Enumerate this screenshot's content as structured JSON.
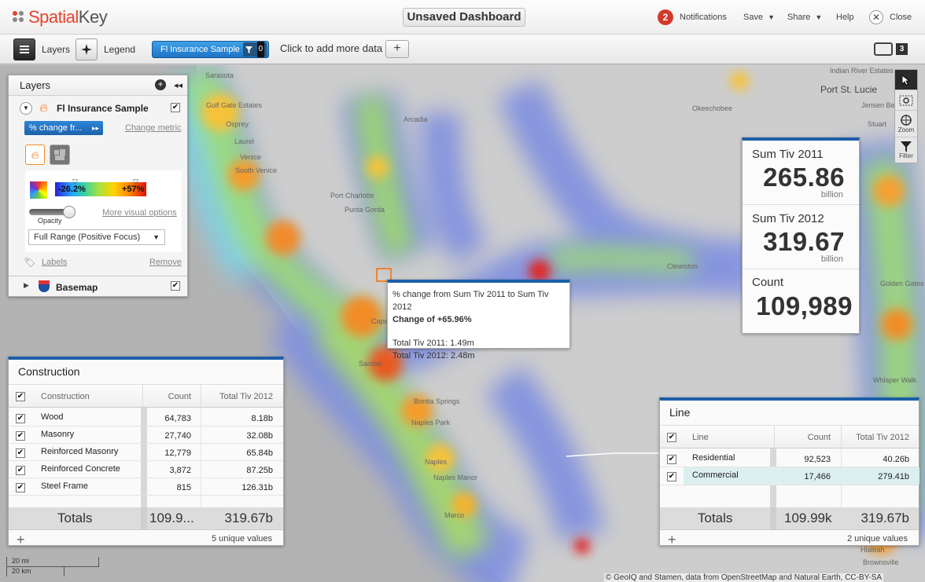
{
  "app": {
    "logo": "SpatialKey",
    "dashboard_title": "Unsaved Dashboard"
  },
  "topmenu": {
    "notif_count": "2",
    "notifications": "Notifications",
    "save": "Save",
    "share": "Share",
    "help": "Help",
    "close": "Close"
  },
  "toolbar": {
    "layers": "Layers",
    "legend": "Legend",
    "dataset": "Fl Insurance Sample",
    "dataset_filter_count": "0",
    "add_data_text": "Click to add more data",
    "add_data_symbol": "+",
    "screen_count": "3"
  },
  "layers_panel": {
    "title": "Layers",
    "layer_name": "Fl Insurance Sample",
    "metric": "% change fr...",
    "change_metric": "Change metric",
    "range_min": "-26.2%",
    "range_max": "+57%",
    "opacity_label": "Opacity",
    "more_visual": "More visual options",
    "range_option": "Full Range (Positive Focus)",
    "labels": "Labels",
    "remove": "Remove",
    "basemap": "Basemap"
  },
  "map_controls": {
    "zoom": "Zoom",
    "filter": "Filter"
  },
  "stats": [
    {
      "label": "Sum Tiv 2011",
      "value": "265.86",
      "unit": "billion"
    },
    {
      "label": "Sum Tiv 2012",
      "value": "319.67",
      "unit": "billion"
    },
    {
      "label": "Count",
      "value": "109,989",
      "unit": ""
    }
  ],
  "tooltip": {
    "line1": "% change from Sum Tiv 2011 to Sum Tiv 2012",
    "line2": "Change of +65.96%",
    "line3": "Total Tiv 2011: 1.49m",
    "line4": "Total Tiv 2012: 2.48m"
  },
  "construction": {
    "title": "Construction",
    "headers": [
      "Construction",
      "Count",
      "Total Tiv 2012"
    ],
    "rows": [
      [
        "Wood",
        "64,783",
        "8.18b"
      ],
      [
        "Masonry",
        "27,740",
        "32.08b"
      ],
      [
        "Reinforced Masonry",
        "12,779",
        "65.84b"
      ],
      [
        "Reinforced Concrete",
        "3,872",
        "87.25b"
      ],
      [
        "Steel Frame",
        "815",
        "126.31b"
      ]
    ],
    "totals_label": "Totals",
    "totals_count": "109.9...",
    "totals_tiv": "319.67b",
    "footer": "5 unique values"
  },
  "line": {
    "title": "Line",
    "headers": [
      "Line",
      "Count",
      "Total Tiv 2012"
    ],
    "rows": [
      [
        "Residential",
        "92,523",
        "40.26b"
      ],
      [
        "Commercial",
        "17,466",
        "279.41b"
      ]
    ],
    "totals_label": "Totals",
    "totals_count": "109.99k",
    "totals_tiv": "319.67b",
    "footer": "2 unique values"
  },
  "map": {
    "cities": [
      "Sarasota",
      "Gulf Gate Estates",
      "Osprey",
      "Laurel",
      "Venice",
      "South Venice",
      "Port Charlotte",
      "Punta Gorda",
      "Arcadia",
      "Okeechobee",
      "Indian River Estates",
      "Port St. Lucie",
      "Jensen Beach",
      "Stuart",
      "Clewiston",
      "Golden Gates",
      "Sanibel",
      "Cape Coral",
      "Bonita Springs",
      "Naples Park",
      "Naples",
      "Naples Manor",
      "Marco",
      "Whisper Walk",
      "Hialeah",
      "Brownsville"
    ],
    "scale_mi": "20 mi",
    "scale_km": "20 km",
    "attribution": "© GeoIQ and Stamen, data from OpenStreetMap and Natural Earth, CC-BY-SA"
  },
  "colors": {
    "accent": "#1c5fa8",
    "pill": "#2f86d7",
    "badge": "#d43a2b"
  }
}
